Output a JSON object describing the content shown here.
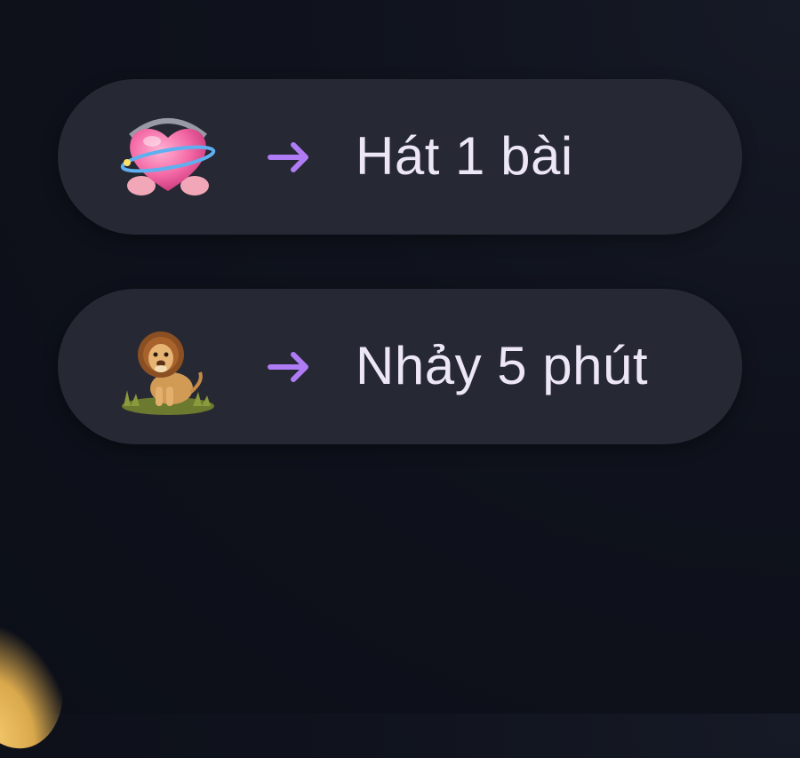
{
  "items": [
    {
      "icon": "heart-with-ribbon-icon",
      "arrow_icon": "arrow-right-icon",
      "label": "Hát 1 bài"
    },
    {
      "icon": "lion-icon",
      "arrow_icon": "arrow-right-icon",
      "label": "Nhảy 5 phút"
    }
  ],
  "colors": {
    "background": "#0f121c",
    "pill": "#262834",
    "arrow": "#b07cf5",
    "label": "#ece6f7",
    "corner_glow": "#f3c76a"
  }
}
